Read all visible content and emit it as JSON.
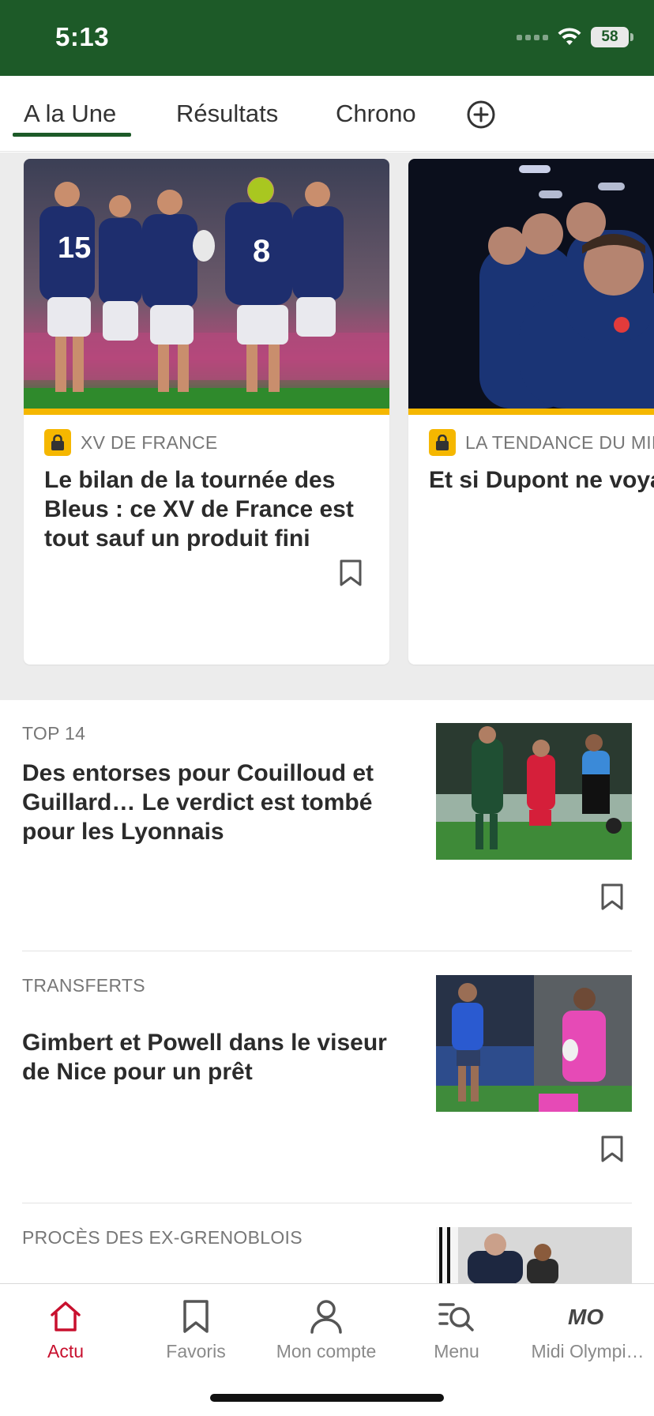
{
  "status_bar": {
    "time": "5:13",
    "battery": "58"
  },
  "tabs": [
    {
      "label": "A la Une"
    },
    {
      "label": "Résultats"
    },
    {
      "label": "Chrono"
    }
  ],
  "carousel": [
    {
      "kicker": "XV DE FRANCE",
      "title": "Le bilan de la tournée des Bleus : ce XV de France est tout sauf un produit fini",
      "premium": true
    },
    {
      "kicker": "LA TENDANCE DU MIDI",
      "title": "Et si Dupont ne voyageait pas jusqu'à l’Eden Park…",
      "premium": true
    }
  ],
  "articles": [
    {
      "kicker": "TOP 14",
      "title": "Des entorses pour Couilloud et Guillard… Le verdict est tombé pour les Lyonnais"
    },
    {
      "kicker": "TRANSFERTS",
      "title": "Gimbert et Powell dans le viseur de Nice pour un prêt"
    },
    {
      "kicker": "PROCÈS DES EX-GRENOBLOIS",
      "title": ""
    }
  ],
  "bottom_nav": [
    {
      "label": "Actu",
      "icon": "home-icon",
      "active": true
    },
    {
      "label": "Favoris",
      "icon": "bookmark-icon",
      "active": false
    },
    {
      "label": "Mon compte",
      "icon": "user-icon",
      "active": false
    },
    {
      "label": "Menu",
      "icon": "menu-search-icon",
      "active": false
    },
    {
      "label": "Midi Olympi…",
      "icon": "mo-logo-icon",
      "active": false
    }
  ],
  "colors": {
    "brand_green": "#1d5a28",
    "premium_yellow": "#f5b700",
    "active_red": "#c8102e"
  }
}
